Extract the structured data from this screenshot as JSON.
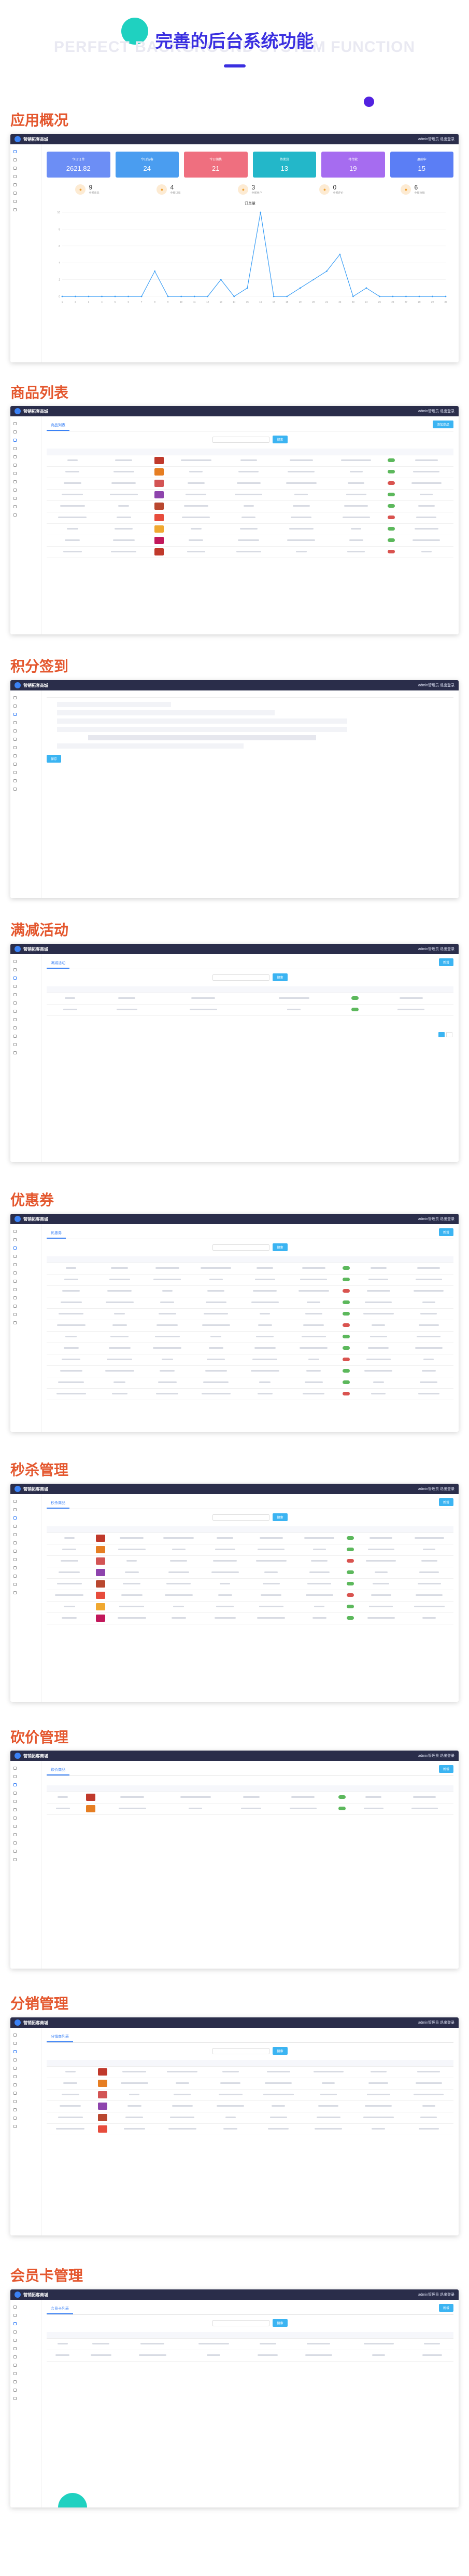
{
  "hero": {
    "title": "完善的后台系统功能",
    "bg_text": "PERFECT BACKGROUND SYSTEM FUNCTION"
  },
  "brand": {
    "logo_text": "营销拓客商城",
    "top_right": "admin管理员   退出登录"
  },
  "colors": {
    "section_title": "#e4572e",
    "hero_title": "#3a2fe0",
    "accent": "#3bb4f2",
    "topbar": "#2a2d4a"
  },
  "sections": {
    "overview": {
      "title": "应用概况",
      "cards": [
        {
          "label": "今日订单",
          "value": "2621.82",
          "color": "#6c8ef5"
        },
        {
          "label": "今日访客",
          "value": "24",
          "color": "#4a9df0"
        },
        {
          "label": "今日销售",
          "value": "21",
          "color": "#ef6f7f"
        },
        {
          "label": "待发货",
          "value": "13",
          "color": "#23b7c9"
        },
        {
          "label": "待付款",
          "value": "19",
          "color": "#a66cf0"
        },
        {
          "label": "退款中",
          "value": "15",
          "color": "#5b7ef5"
        }
      ],
      "stats": [
        {
          "value": "9",
          "label": "全部商品"
        },
        {
          "value": "4",
          "label": "全部订单"
        },
        {
          "value": "3",
          "label": "全部用户"
        },
        {
          "value": "0",
          "label": "全部评价"
        },
        {
          "value": "6",
          "label": "全部分销"
        }
      ],
      "chart_title": "订单量"
    },
    "goods": {
      "title": "商品列表",
      "tab": "商品列表",
      "add": "添加商品",
      "search_btn": "搜索"
    },
    "points": {
      "title": "积分签到",
      "save": "保存"
    },
    "fullcut": {
      "title": "满减活动",
      "tab": "满减活动",
      "add": "新增",
      "search_btn": "搜索"
    },
    "coupon": {
      "title": "优惠券",
      "tab": "优惠券",
      "add": "新增",
      "search_btn": "搜索"
    },
    "seckill": {
      "title": "秒杀管理",
      "tab": "秒杀商品",
      "add": "新增",
      "search_btn": "搜索"
    },
    "bargain": {
      "title": "砍价管理",
      "tab": "砍价商品",
      "add": "新增",
      "search_btn": "搜索"
    },
    "distribution": {
      "title": "分销管理",
      "tab": "分销商列表",
      "search_btn": "搜索"
    },
    "member": {
      "title": "会员卡管理",
      "tab": "会员卡列表",
      "add": "新增",
      "search_btn": "搜索"
    }
  },
  "chart_data": {
    "type": "line",
    "title": "订单量",
    "x": [
      1,
      2,
      3,
      4,
      5,
      6,
      7,
      8,
      9,
      10,
      11,
      12,
      13,
      14,
      15,
      16,
      17,
      18,
      19,
      20,
      21,
      22,
      23,
      24,
      25,
      26,
      27,
      28,
      29,
      30
    ],
    "series": [
      {
        "values": [
          0,
          0,
          0,
          0,
          0,
          0,
          0,
          3,
          0,
          0,
          0,
          0,
          2,
          0,
          1,
          10,
          0,
          0,
          1,
          2,
          3,
          5,
          0,
          1,
          0,
          0,
          0,
          0,
          0,
          0
        ]
      }
    ],
    "ylim": [
      0,
      10
    ]
  }
}
